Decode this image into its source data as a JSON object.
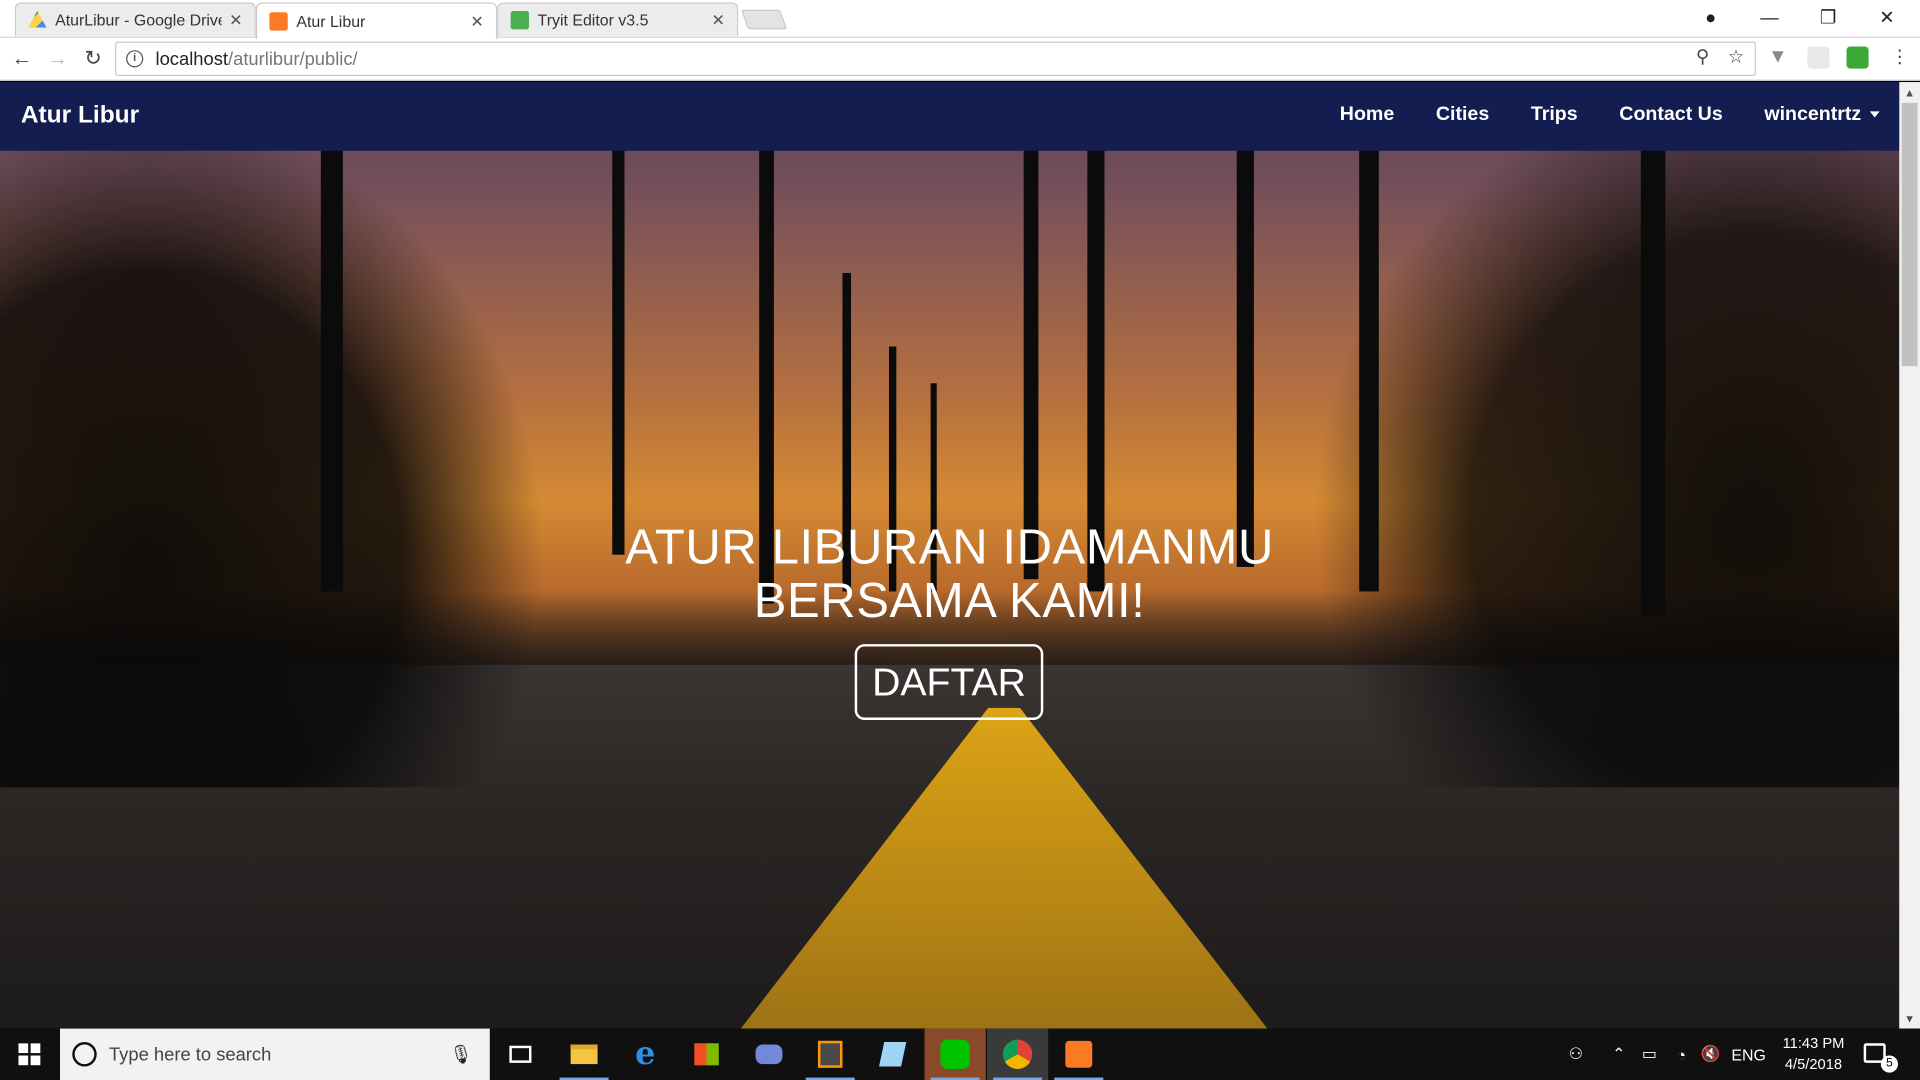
{
  "browser": {
    "tabs": [
      {
        "title": "AturLibur - Google Drive",
        "icon": "google-drive-icon"
      },
      {
        "title": "Atur Libur",
        "icon": "xampp-icon"
      },
      {
        "title": "Tryit Editor v3.5",
        "icon": "w3schools-icon"
      }
    ],
    "url_host": "localhost",
    "url_path": "/aturlibur/public/",
    "colors": {
      "drive_green": "#1fa463",
      "xampp_orange": "#fb7a24",
      "w3_green": "#4caf50"
    }
  },
  "site": {
    "brand": "Atur Libur",
    "nav": [
      {
        "label": "Home"
      },
      {
        "label": "Cities"
      },
      {
        "label": "Trips"
      },
      {
        "label": "Contact Us"
      }
    ],
    "user": "wincentrtz",
    "navbar_color": "#141d4f",
    "hero": {
      "title_line1": "ATUR LIBURAN IDAMANMU",
      "title_line2": "BERSAMA KAMI!",
      "button": "DAFTAR"
    }
  },
  "taskbar": {
    "search_placeholder": "Type here to search",
    "apps": [
      "task-view-icon",
      "file-explorer-icon",
      "edge-icon",
      "store-icon",
      "discord-icon",
      "sublime-text-icon",
      "notepad-icon",
      "line-icon",
      "chrome-icon",
      "xampp-icon"
    ],
    "language": "ENG",
    "time": "11:43 PM",
    "date": "4/5/2018",
    "notifications": "5"
  }
}
